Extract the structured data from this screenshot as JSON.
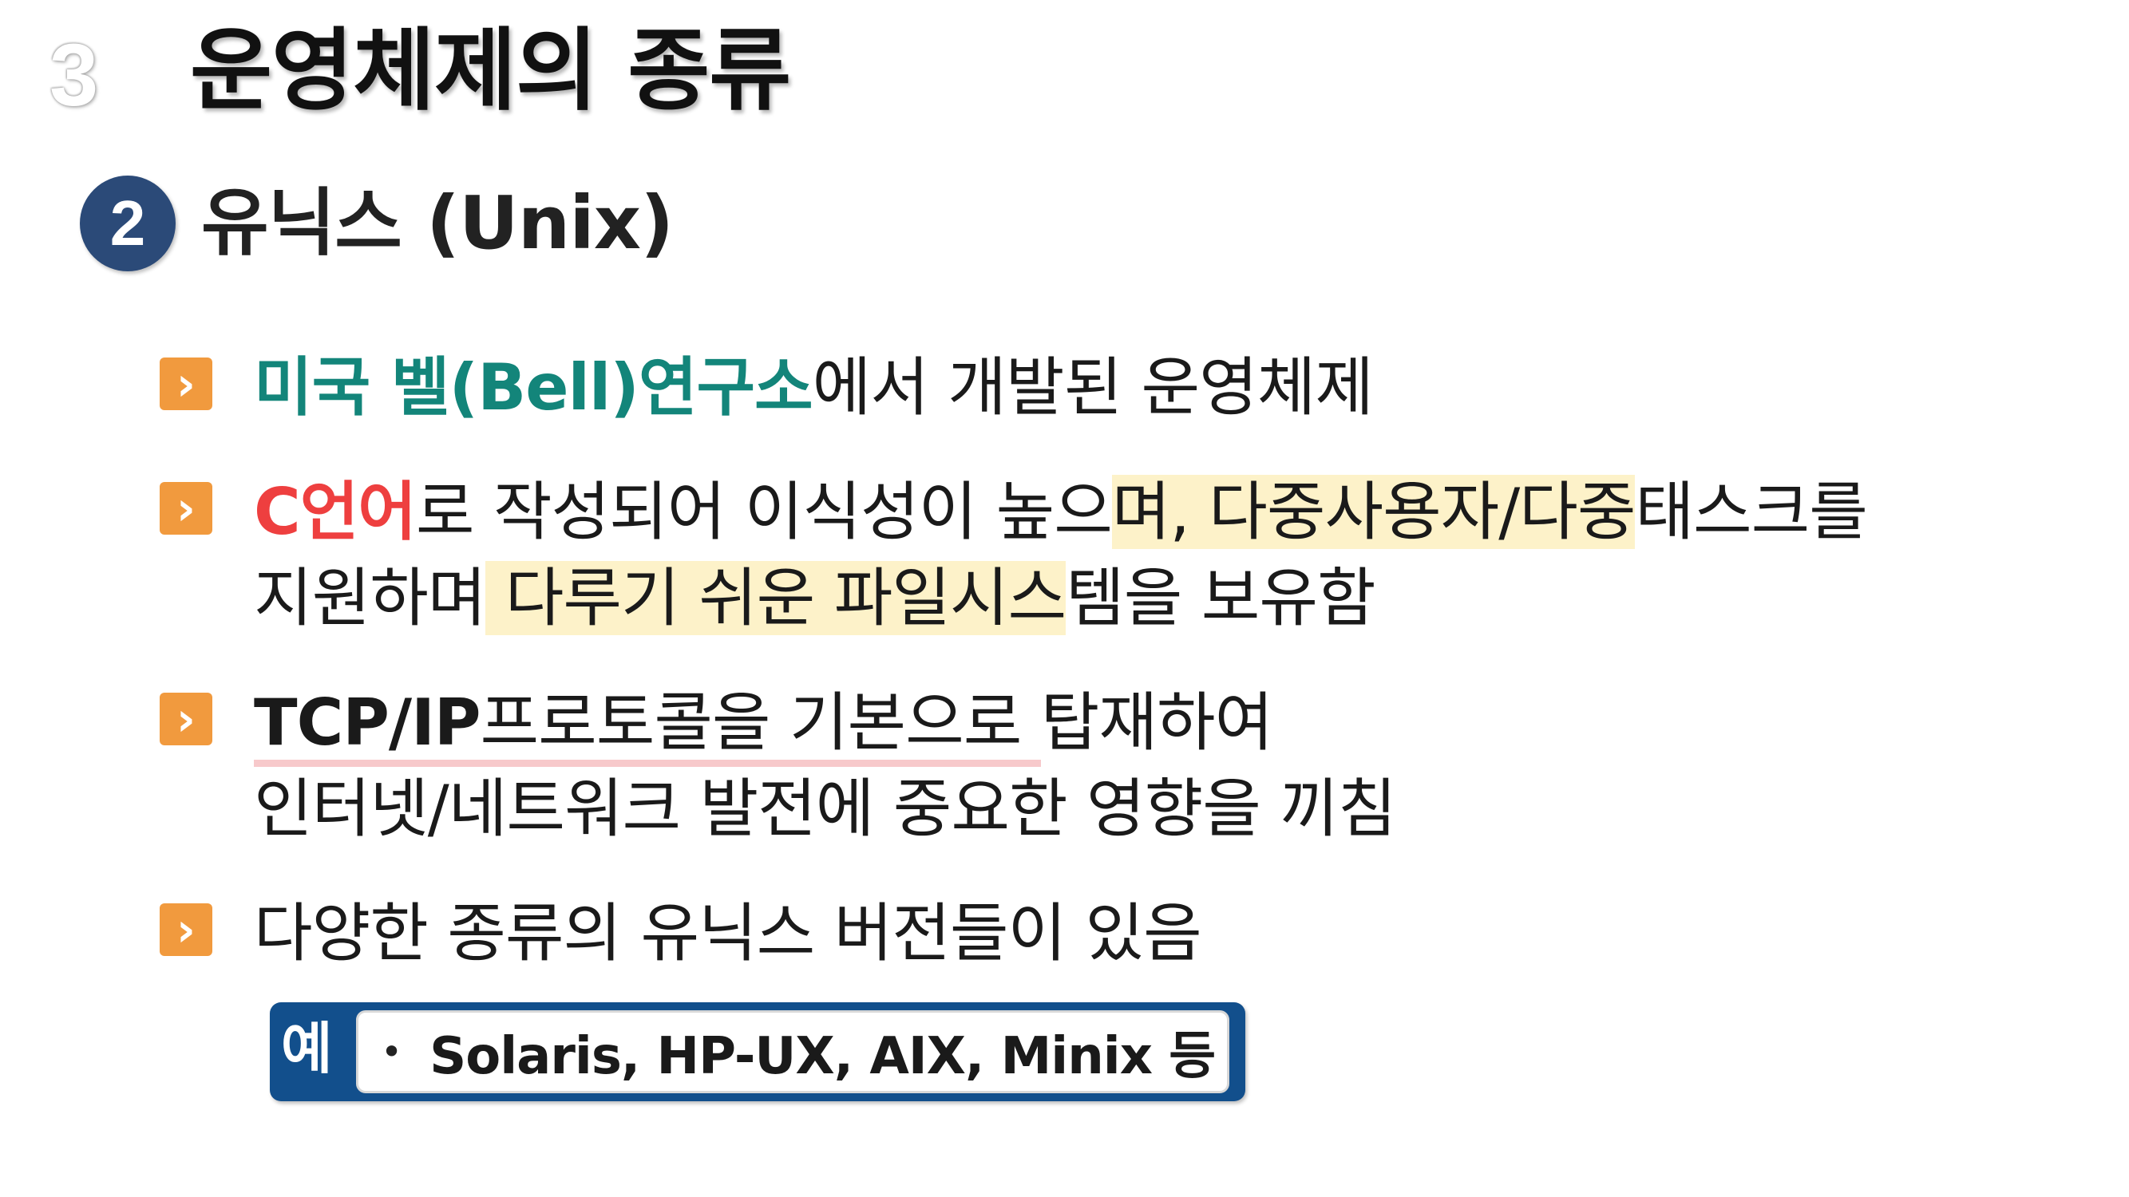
{
  "slide": {
    "number": "3",
    "title": "운영체제의 종류"
  },
  "section": {
    "badge": "2",
    "title": "유닉스 (Unix)"
  },
  "bullets": [
    {
      "parts": [
        "미국 벨(Bell)연구소",
        "에서 개발된 운영체제"
      ]
    },
    {
      "parts": [
        "C언어",
        "로 작성되어 이식성이 높으",
        "며, 다중사용자/다중",
        "태스크를",
        "지원하며",
        " 다루기 쉬운 파일시스",
        "템을 보유함"
      ]
    },
    {
      "parts": [
        "TCP/IP",
        "프로토콜을 기본으로 ",
        "탑재하여",
        "인터넷/네트워크 발전에 중요한 영향을 끼침"
      ]
    },
    {
      "parts": [
        "다양한 종류의 유닉스 버전들이 있음"
      ]
    }
  ],
  "example": {
    "label": "예",
    "bullet": "•",
    "text": "Solaris, HP-UX, AIX, Minix 등"
  },
  "colors": {
    "accent_orange": "#f19a3e",
    "teal": "#13857a",
    "red": "#ee3f3f",
    "navy": "#124f8c",
    "highlight": "#fdf2c9",
    "underline": "#f7c9cb"
  }
}
